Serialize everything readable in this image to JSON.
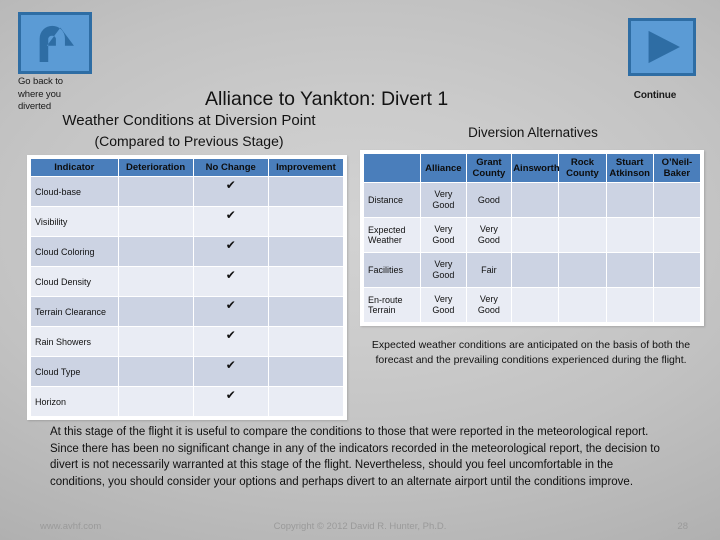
{
  "nav": {
    "back_icon": "u-turn-arrow-icon",
    "back_caption": "Go back to where you diverted",
    "continue_icon": "play-triangle-icon",
    "continue_label": "Continue"
  },
  "title": "Alliance to Yankton: Divert 1",
  "left_panel": {
    "heading": "Weather Conditions at Diversion Point",
    "subheading": "(Compared to Previous Stage)",
    "columns": [
      "Indicator",
      "Deterioration",
      "No Change",
      "Improvement"
    ],
    "rows": [
      {
        "indicator": "Cloud-base",
        "deterioration": "",
        "no_change": "✔",
        "improvement": ""
      },
      {
        "indicator": "Visibility",
        "deterioration": "",
        "no_change": "✔",
        "improvement": ""
      },
      {
        "indicator": "Cloud Coloring",
        "deterioration": "",
        "no_change": "✔",
        "improvement": ""
      },
      {
        "indicator": "Cloud Density",
        "deterioration": "",
        "no_change": "✔",
        "improvement": ""
      },
      {
        "indicator": "Terrain Clearance",
        "deterioration": "",
        "no_change": "✔",
        "improvement": ""
      },
      {
        "indicator": "Rain Showers",
        "deterioration": "",
        "no_change": "✔",
        "improvement": ""
      },
      {
        "indicator": "Cloud Type",
        "deterioration": "",
        "no_change": "✔",
        "improvement": ""
      },
      {
        "indicator": "Horizon",
        "deterioration": "",
        "no_change": "✔",
        "improvement": ""
      }
    ]
  },
  "right_panel": {
    "heading": "Diversion Alternatives",
    "columns": [
      "",
      "Alliance",
      "Grant County",
      "Ainsworth",
      "Rock County",
      "Stuart Atkinson",
      "O’Neil-Baker"
    ],
    "rows": [
      {
        "criterion": "Distance",
        "alliance": "Very Good",
        "grant_county": "Good",
        "ainsworth": "",
        "rock_county": "",
        "stuart_atkinson": "",
        "oneil_baker": ""
      },
      {
        "criterion": "Expected Weather",
        "alliance": "Very Good",
        "grant_county": "Very Good",
        "ainsworth": "",
        "rock_county": "",
        "stuart_atkinson": "",
        "oneil_baker": ""
      },
      {
        "criterion": "Facilities",
        "alliance": "Very Good",
        "grant_county": "Fair",
        "ainsworth": "",
        "rock_county": "",
        "stuart_atkinson": "",
        "oneil_baker": ""
      },
      {
        "criterion": "En-route Terrain",
        "alliance": "Very Good",
        "grant_county": "Very Good",
        "ainsworth": "",
        "rock_county": "",
        "stuart_atkinson": "",
        "oneil_baker": ""
      }
    ],
    "note": "Expected weather conditions are anticipated on the basis of both the forecast and the prevailing conditions experienced during the flight."
  },
  "bottom_note": "At this stage of the flight it is useful to compare the conditions to those that were reported in the meteorological report.  Since there has been no significant change in any of the indicators recorded in the meteorological report, the decision to divert is not necessarily warranted at this stage of the flight.  Nevertheless, should you feel uncomfortable in the conditions, you should consider your options and perhaps divert to an alternate airport until the conditions improve.",
  "footer": {
    "url": "www.avhf.com",
    "copyright": "Copyright © 2012 David R. Hunter, Ph.D.",
    "page": "28"
  },
  "colors": {
    "header_blue": "#4a7ebb",
    "button_blue": "#5b9bd5",
    "button_border": "#2e6da4",
    "row_dark": "#ccd3e3",
    "row_light": "#e9ecf4"
  }
}
